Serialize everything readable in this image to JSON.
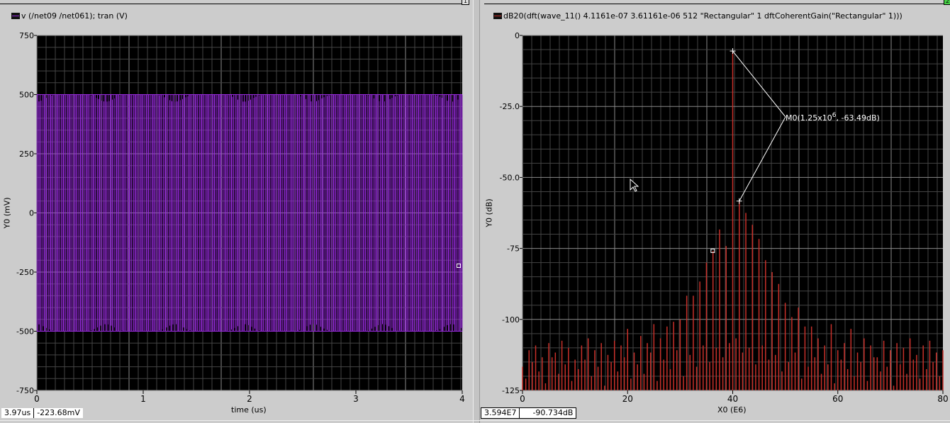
{
  "left_panel": {
    "window_badge": "1",
    "legend": "v (/net09 /net061); tran (V)",
    "trace_color": "#9a2be0",
    "readout": {
      "x": "3.97us",
      "y": "-223.68mV"
    }
  },
  "right_panel": {
    "window_badge": "2",
    "legend": "dB20(dft(wave_11() 4.1161e-07 3.61161e-06 512 \"Rectangular\" 1 dftCoherentGain(\"Rectangular\" 1)))",
    "trace_color": "#c8302a",
    "readout": {
      "x": "3.594E7",
      "y": "-90.734dB"
    },
    "marker_label": "M0(1.25x10",
    "marker_exp": "6",
    "marker_label_tail": ", -63.49dB)"
  },
  "chart_data": [
    {
      "type": "line",
      "xlabel": "time (us)",
      "ylabel": "Y0 (mV)",
      "xlim": [
        0,
        4
      ],
      "ylim": [
        -750,
        750
      ],
      "xticks": [
        "0",
        "1",
        "2",
        "3",
        "4"
      ],
      "yticks": [
        "750",
        "500",
        "250",
        "0",
        "-250",
        "-500",
        "-750"
      ],
      "grid": true,
      "signal_peak_mV": 500,
      "signal_trough_mV": -500,
      "color": "#9a2be0"
    },
    {
      "type": "bar",
      "xlabel": "X0 (E6)",
      "ylabel": "Y0 (dB)",
      "xlim": [
        0,
        80
      ],
      "ylim": [
        -150,
        0
      ],
      "xticks": [
        "0",
        "20",
        "40",
        "60",
        "80"
      ],
      "yticks": [
        "0",
        "-25.0",
        "-50.0",
        "-75",
        "-100",
        "-125"
      ],
      "grid": true,
      "color": "#c8302a",
      "bins_main": {
        "x_start": 0,
        "x_step": 1.25,
        "values": [
          -140,
          -133,
          -131,
          -136,
          -130,
          -134,
          -129,
          -132,
          -137,
          -131,
          -128,
          -133,
          -130,
          -135,
          -129,
          -131,
          -124,
          -134,
          -127,
          -130,
          -122,
          -128,
          -123,
          -121,
          -120,
          -110,
          -110,
          -104,
          -96,
          -91,
          -82,
          -89,
          -6.6,
          -70,
          -75,
          -80,
          -86,
          -95,
          -100,
          -105,
          -113,
          -119,
          -115,
          -123,
          -123,
          -128,
          -131,
          -122,
          -133,
          -130,
          -124,
          -134,
          -128,
          -131,
          -136,
          -129,
          -133,
          -130,
          -132,
          -128,
          -135,
          -131,
          -129,
          -134,
          -133
        ]
      },
      "bins_secondary": {
        "x_start": 0.625,
        "x_step": 1.25,
        "values": [
          -145,
          -138,
          -142,
          -147,
          -136,
          -143,
          -139,
          -146,
          -141,
          -137,
          -144,
          -140,
          -148,
          -138,
          -142,
          -136,
          -145,
          -139,
          -143,
          -134,
          -146,
          -137,
          -141,
          -133,
          -144,
          -135,
          -140,
          -131,
          -138,
          -132,
          -136,
          -130,
          -128,
          -134,
          -132,
          -139,
          -131,
          -137,
          -135,
          -142,
          -138,
          -134,
          -145,
          -140,
          -136,
          -143,
          -139,
          -147,
          -137,
          -141,
          -144,
          -138,
          -146,
          -136,
          -142,
          -140,
          -148,
          -139,
          -143,
          -137,
          -145,
          -141,
          -138,
          -144
        ]
      },
      "markers": [
        {
          "x": 40,
          "y": -6.6
        },
        {
          "x": 41.25,
          "y": -70
        }
      ],
      "marker_square": {
        "x": 36.2,
        "y": -91
      }
    }
  ]
}
